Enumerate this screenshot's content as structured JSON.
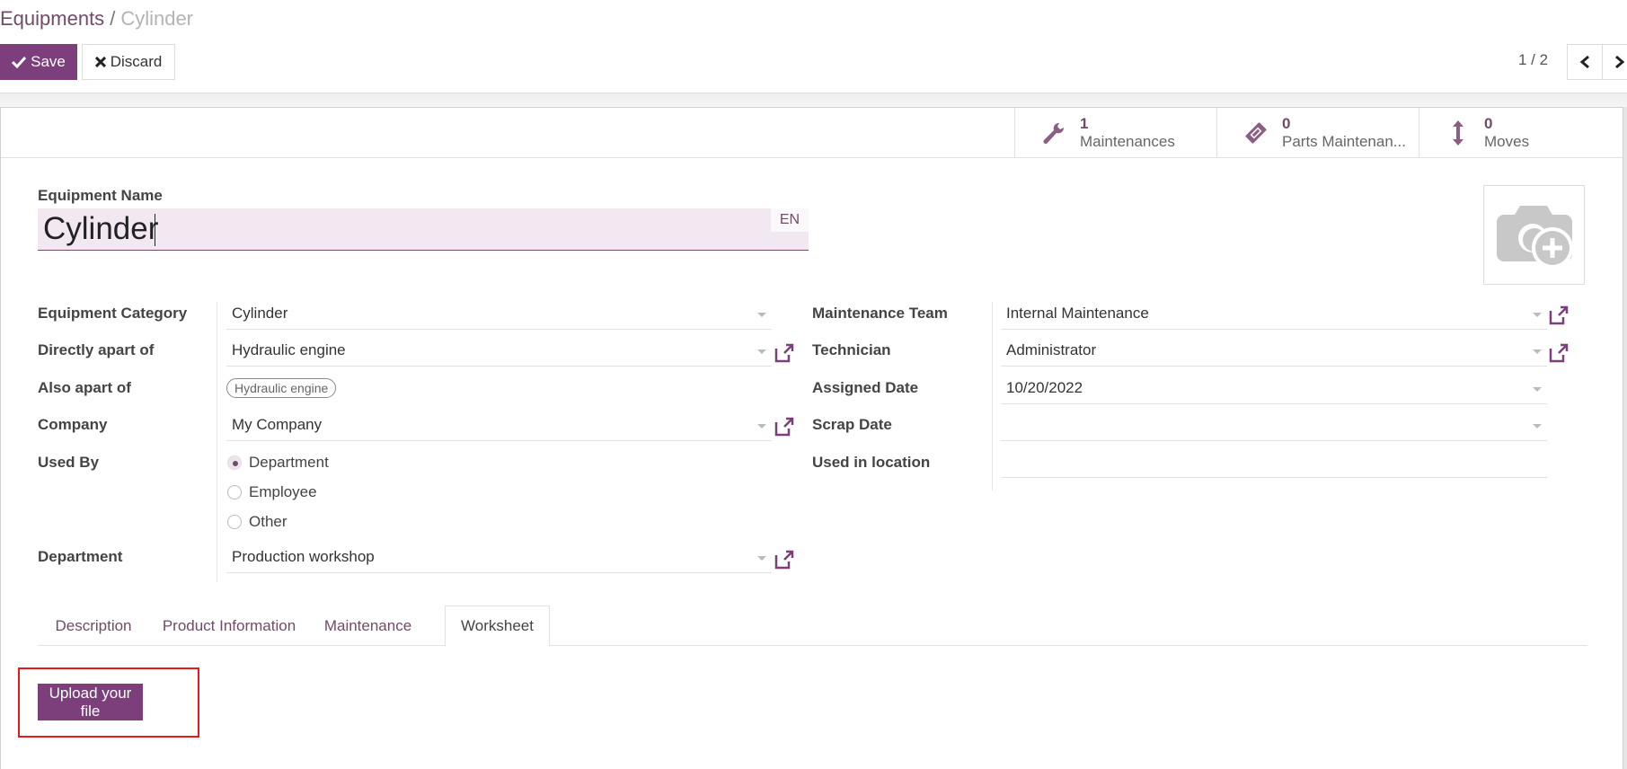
{
  "breadcrumb": {
    "parent": "Equipments",
    "separator": "/",
    "current": "Cylinder"
  },
  "toolbar": {
    "save_label": "Save",
    "discard_label": "Discard"
  },
  "pager": {
    "value": "1 / 2"
  },
  "stat_buttons": [
    {
      "value": "1",
      "label": "Maintenances",
      "icon": "wrench-icon"
    },
    {
      "value": "0",
      "label": "Parts Maintenan...",
      "icon": "ticket-icon"
    },
    {
      "value": "0",
      "label": "Moves",
      "icon": "arrows-vertical-icon"
    }
  ],
  "equipment_name": {
    "label": "Equipment Name",
    "value": "Cylinder",
    "lang": "EN"
  },
  "left_fields": {
    "category": {
      "label": "Equipment Category",
      "value": "Cylinder"
    },
    "directly_apart": {
      "label": "Directly apart of",
      "value": "Hydraulic engine"
    },
    "also_apart": {
      "label": "Also apart of",
      "tags": [
        "Hydraulic engine"
      ]
    },
    "company": {
      "label": "Company",
      "value": "My Company"
    },
    "used_by": {
      "label": "Used By",
      "options": [
        "Department",
        "Employee",
        "Other"
      ],
      "selected": "Department"
    },
    "department": {
      "label": "Department",
      "value": "Production workshop"
    }
  },
  "right_fields": {
    "team": {
      "label": "Maintenance Team",
      "value": "Internal Maintenance"
    },
    "technician": {
      "label": "Technician",
      "value": "Administrator"
    },
    "assigned_date": {
      "label": "Assigned Date",
      "value": "10/20/2022"
    },
    "scrap_date": {
      "label": "Scrap Date",
      "value": ""
    },
    "location": {
      "label": "Used in location",
      "value": ""
    }
  },
  "tabs": [
    {
      "label": "Description",
      "active": false
    },
    {
      "label": "Product Information",
      "active": false
    },
    {
      "label": "Maintenance",
      "active": false
    },
    {
      "label": "Worksheet",
      "active": true
    }
  ],
  "worksheet": {
    "upload_label": "Upload your file"
  },
  "colors": {
    "brand": "#714b67",
    "button": "#7c3f7c",
    "highlight": "#e31b1b"
  }
}
